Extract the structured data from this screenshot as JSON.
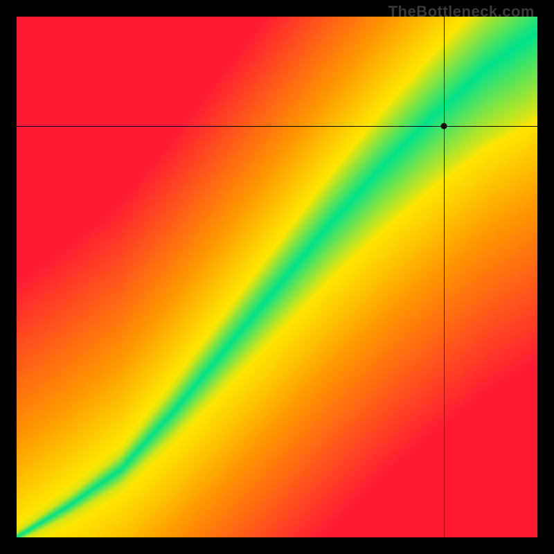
{
  "watermark": "TheBottleneck.com",
  "chart_data": {
    "type": "heatmap",
    "title": "",
    "xlabel": "",
    "ylabel": "",
    "xlim": [
      0,
      100
    ],
    "ylim": [
      0,
      100
    ],
    "grid": false,
    "legend": false,
    "marker": {
      "x": 82,
      "y": 79
    },
    "crosshair": {
      "x": 82,
      "y": 79
    },
    "optimal_ridge_description": "green optimal band along a curved diagonal; red = high bottleneck, yellow = moderate",
    "color_stops": {
      "best": "#00e28a",
      "good": "#ffe600",
      "mid": "#ff9a00",
      "bad": "#ff1a33"
    },
    "ridge_samples": [
      {
        "x": 0,
        "y": 0
      },
      {
        "x": 10,
        "y": 6
      },
      {
        "x": 20,
        "y": 13
      },
      {
        "x": 30,
        "y": 24
      },
      {
        "x": 40,
        "y": 36
      },
      {
        "x": 50,
        "y": 48
      },
      {
        "x": 60,
        "y": 60
      },
      {
        "x": 70,
        "y": 71
      },
      {
        "x": 80,
        "y": 81
      },
      {
        "x": 90,
        "y": 90
      },
      {
        "x": 100,
        "y": 97
      }
    ],
    "ridge_width_samples": [
      {
        "x": 0,
        "w": 1
      },
      {
        "x": 20,
        "w": 3
      },
      {
        "x": 40,
        "w": 6
      },
      {
        "x": 60,
        "w": 9
      },
      {
        "x": 80,
        "w": 12
      },
      {
        "x": 100,
        "w": 15
      }
    ]
  }
}
